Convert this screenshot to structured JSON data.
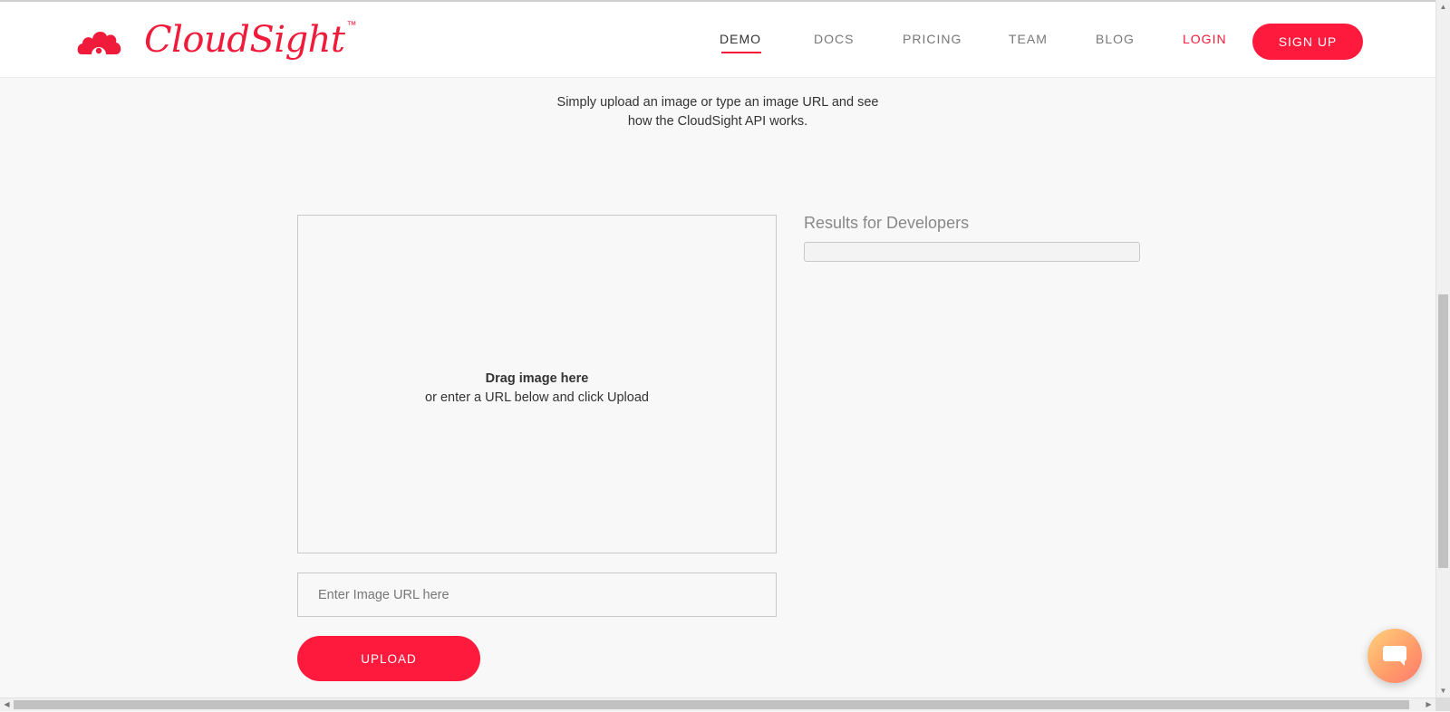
{
  "brand": {
    "name": "CloudSight",
    "trademark": "™",
    "accent_color": "#f01a3a",
    "logo_icon": "cloud-eye-icon"
  },
  "nav": {
    "items": [
      {
        "label": "DEMO",
        "active": true
      },
      {
        "label": "DOCS"
      },
      {
        "label": "PRICING"
      },
      {
        "label": "TEAM"
      },
      {
        "label": "BLOG"
      }
    ],
    "login_label": "LOGIN",
    "signup_label": "SIGN UP"
  },
  "intro": {
    "line1": "Simply upload an image or type an image URL and see",
    "line2": "how the CloudSight API works."
  },
  "dropzone": {
    "title": "Drag image here",
    "subtitle": "or enter a URL below and click Upload"
  },
  "url_input": {
    "placeholder": "Enter Image URL here",
    "value": ""
  },
  "upload_label": "UPLOAD",
  "results": {
    "title": "Results for Developers"
  },
  "chat": {
    "icon": "chat-bubble-icon"
  }
}
